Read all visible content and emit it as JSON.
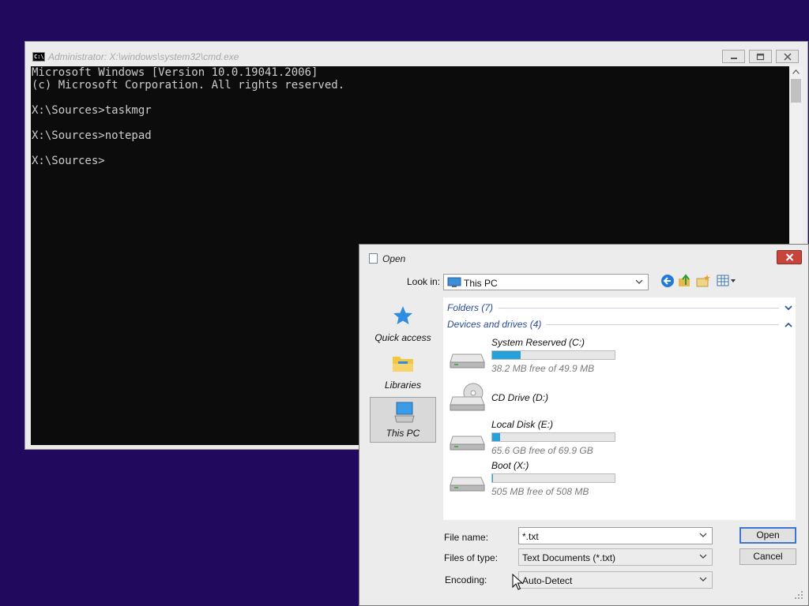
{
  "cmd": {
    "title": "Administrator: X:\\windows\\system32\\cmd.exe",
    "icon_text": "C:\\",
    "lines": [
      "Microsoft Windows [Version 10.0.19041.2006]",
      "(c) Microsoft Corporation. All rights reserved.",
      "",
      "X:\\Sources>taskmgr",
      "",
      "X:\\Sources>notepad",
      "",
      "X:\\Sources>"
    ]
  },
  "dialog": {
    "title": "Open",
    "look_in_label": "Look in:",
    "look_in_value": "This PC",
    "places": [
      {
        "label": "Quick access",
        "icon": "star-icon",
        "selected": false
      },
      {
        "label": "Libraries",
        "icon": "libraries-folder-icon",
        "selected": false
      },
      {
        "label": "This PC",
        "icon": "computer-icon",
        "selected": true
      }
    ],
    "groups": {
      "folders": "Folders (7)",
      "devices": "Devices and drives (4)"
    },
    "drives": [
      {
        "name": "System Reserved (C:)",
        "free_text": "38.2 MB free of 49.9 MB",
        "used_fraction": 0.234,
        "has_bar": true,
        "icon": "hard-drive-icon"
      },
      {
        "name": "CD Drive (D:)",
        "free_text": "",
        "used_fraction": 0,
        "has_bar": false,
        "icon": "cd-drive-icon"
      },
      {
        "name": "Local Disk (E:)",
        "free_text": "65.6 GB free of 69.9 GB",
        "used_fraction": 0.062,
        "has_bar": true,
        "icon": "hard-drive-icon"
      },
      {
        "name": "Boot (X:)",
        "free_text": "505 MB free of 508 MB",
        "used_fraction": 0.006,
        "has_bar": true,
        "icon": "hard-drive-icon"
      }
    ],
    "file_name_label": "File name:",
    "file_name_value": "*.txt",
    "file_type_label": "Files of type:",
    "file_type_value": "Text Documents (*.txt)",
    "encoding_label": "Encoding:",
    "encoding_value": "Auto-Detect",
    "open_label": "Open",
    "cancel_label": "Cancel"
  },
  "colors": {
    "desktop": "#1f0a5e",
    "console_bg": "#0c0c0c",
    "console_text": "#cccccc",
    "drive_bar_fill": "#26a0da",
    "close_button": "#c8453b",
    "group_header": "#2a4a9a"
  }
}
